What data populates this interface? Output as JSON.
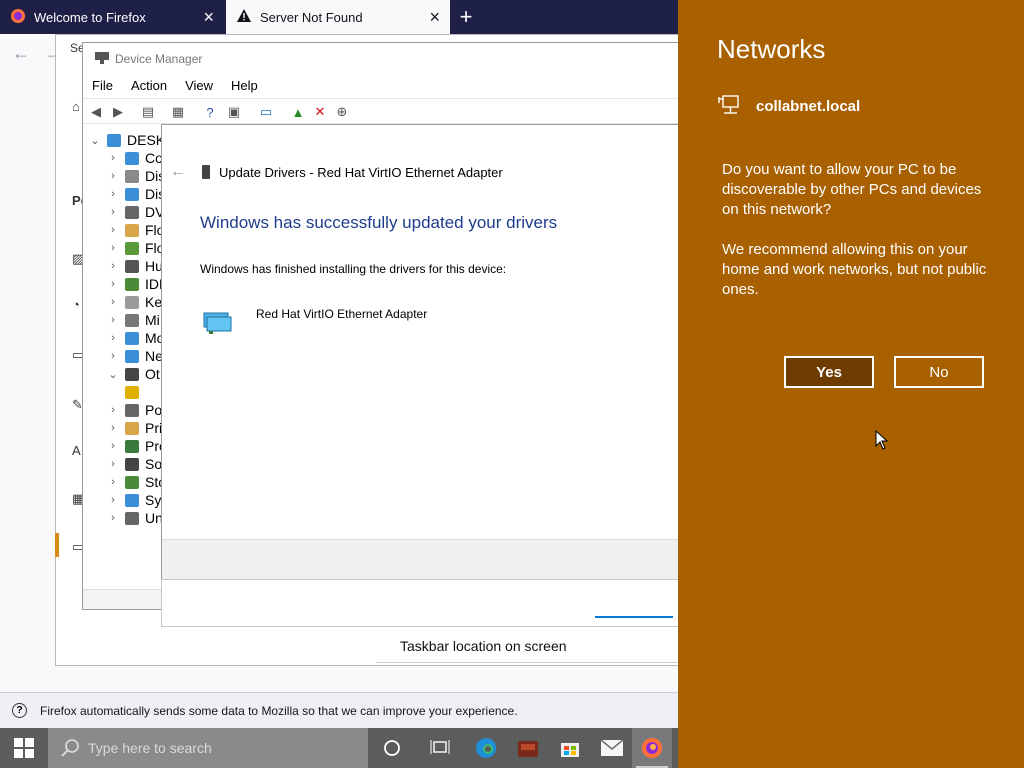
{
  "browser": {
    "tabs": [
      {
        "title": "Welcome to Firefox",
        "icon": "firefox-icon",
        "active": false
      },
      {
        "title": "Server Not Found",
        "icon": "warning-icon",
        "active": true
      }
    ],
    "notification": "Firefox automatically sends some data to Mozilla so that we can improve your experience."
  },
  "settings_window": {
    "search_fragment": "Se",
    "section_fragment": "Pe",
    "taskbar_location_label": "Taskbar location on screen"
  },
  "device_manager": {
    "title": "Device Manager",
    "menu": [
      "File",
      "Action",
      "View",
      "Help"
    ],
    "tree_root": "DESK",
    "tree_items": [
      {
        "label": "Co",
        "expanded": false,
        "color": "#3b8fd6"
      },
      {
        "label": "Dis",
        "expanded": false,
        "color": "#8a8a8a"
      },
      {
        "label": "Dis",
        "expanded": false,
        "color": "#3b8fd6"
      },
      {
        "label": "DV",
        "expanded": false,
        "color": "#666666"
      },
      {
        "label": "Flo",
        "expanded": false,
        "color": "#d8a64a"
      },
      {
        "label": "Flo",
        "expanded": false,
        "color": "#5a9a3a"
      },
      {
        "label": "Hu",
        "expanded": false,
        "color": "#555555"
      },
      {
        "label": "IDE",
        "expanded": false,
        "color": "#4c8a3a"
      },
      {
        "label": "Ke",
        "expanded": false,
        "color": "#9a9a9a"
      },
      {
        "label": "Mi",
        "expanded": false,
        "color": "#777777"
      },
      {
        "label": "Mo",
        "expanded": false,
        "color": "#3b8fd6"
      },
      {
        "label": "Ne",
        "expanded": false,
        "color": "#3b8fd6"
      },
      {
        "label": "Ot",
        "expanded": true,
        "color": "#444444"
      },
      {
        "label": "",
        "expanded": null,
        "color": "#e0b000"
      },
      {
        "label": "Po",
        "expanded": false,
        "color": "#666666"
      },
      {
        "label": "Pri",
        "expanded": false,
        "color": "#d8a64a"
      },
      {
        "label": "Pro",
        "expanded": false,
        "color": "#3a7a3a"
      },
      {
        "label": "So",
        "expanded": false,
        "color": "#444444"
      },
      {
        "label": "Sto",
        "expanded": false,
        "color": "#4c8a3a"
      },
      {
        "label": "Sy",
        "expanded": false,
        "color": "#3b8fd6"
      },
      {
        "label": "Un",
        "expanded": false,
        "color": "#666666"
      }
    ]
  },
  "update_dialog": {
    "title": "Update Drivers - Red Hat VirtIO Ethernet Adapter",
    "heading": "Windows has successfully updated your drivers",
    "description": "Windows has finished installing the drivers for this device:",
    "device_name": "Red Hat VirtIO Ethernet Adapter"
  },
  "taskbar": {
    "search_placeholder": "Type here to search",
    "apps": [
      "cortana-icon",
      "task-view-icon",
      "edge-icon",
      "game-icon",
      "store-icon",
      "mail-icon",
      "firefox-icon"
    ]
  },
  "networks_flyout": {
    "title": "Networks",
    "network_name": "collabnet.local",
    "question": "Do you want to allow your PC to be discoverable by other PCs and devices on this network?",
    "recommendation": "We recommend allowing this on your home and work networks, but not public ones.",
    "yes_label": "Yes",
    "no_label": "No",
    "accent_color": "#a86000"
  }
}
